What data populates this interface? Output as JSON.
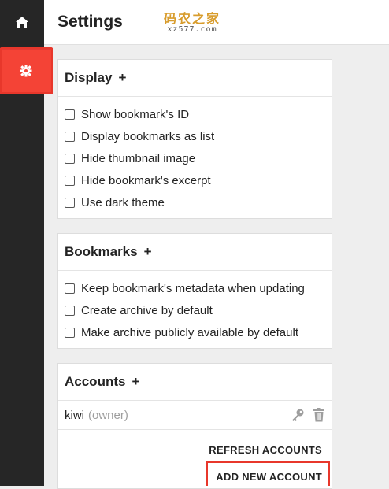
{
  "sidebar": {
    "home_icon": "home-icon",
    "settings_icon": "gear-icon",
    "accent": "#f44336"
  },
  "header": {
    "title": "Settings"
  },
  "watermark": {
    "top": "码农之家",
    "bottom": "xz577.com"
  },
  "display": {
    "title": "Display",
    "plus": "+",
    "options": [
      {
        "label": "Show bookmark's ID",
        "checked": false
      },
      {
        "label": "Display bookmarks as list",
        "checked": false
      },
      {
        "label": "Hide thumbnail image",
        "checked": false
      },
      {
        "label": "Hide bookmark's excerpt",
        "checked": false
      },
      {
        "label": "Use dark theme",
        "checked": false
      }
    ]
  },
  "bookmarks": {
    "title": "Bookmarks",
    "plus": "+",
    "options": [
      {
        "label": "Keep bookmark's metadata when updating",
        "checked": false
      },
      {
        "label": "Create archive by default",
        "checked": false
      },
      {
        "label": "Make archive publicly available by default",
        "checked": false
      }
    ]
  },
  "accounts": {
    "title": "Accounts",
    "plus": "+",
    "list": [
      {
        "username": "kiwi",
        "role": "(owner)"
      }
    ],
    "refresh_label": "REFRESH ACCOUNTS",
    "add_label": "ADD NEW ACCOUNT"
  }
}
